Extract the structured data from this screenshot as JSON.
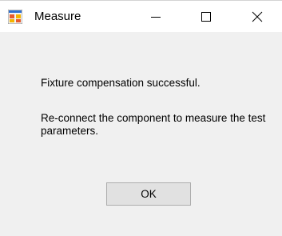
{
  "window": {
    "title": "Measure",
    "icon": "application-icon",
    "controls": {
      "minimize": "minimize-icon",
      "maximize": "maximize-icon",
      "close": "close-icon"
    }
  },
  "message": {
    "line1": "Fixture compensation successful.",
    "line2": "Re-connect the component to measure the test parameters."
  },
  "buttons": {
    "ok_label": "OK"
  },
  "colors": {
    "titlebar_bg": "#ffffff",
    "client_bg": "#f0f0f0",
    "button_bg": "#e1e1e1",
    "button_border": "#adadad"
  }
}
